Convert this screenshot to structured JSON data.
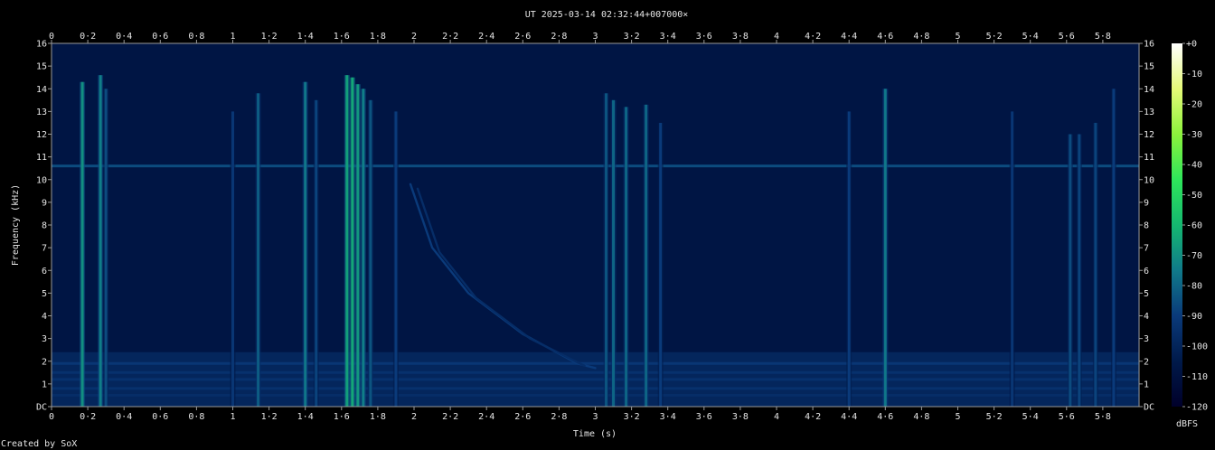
{
  "chart_data": {
    "type": "heatmap",
    "title": "UT 2025-03-14 02:32:44+007000×",
    "xlabel": "Time (s)",
    "ylabel": "Frequency (kHz)",
    "xlim": [
      0,
      6.0
    ],
    "ylim": [
      0,
      16
    ],
    "x_ticks": [
      {
        "value": 0,
        "label": "0"
      },
      {
        "value": 0.2,
        "label": "0·2"
      },
      {
        "value": 0.4,
        "label": "0·4"
      },
      {
        "value": 0.6,
        "label": "0·6"
      },
      {
        "value": 0.8,
        "label": "0·8"
      },
      {
        "value": 1.0,
        "label": "1"
      },
      {
        "value": 1.2,
        "label": "1·2"
      },
      {
        "value": 1.4,
        "label": "1·4"
      },
      {
        "value": 1.6,
        "label": "1·6"
      },
      {
        "value": 1.8,
        "label": "1·8"
      },
      {
        "value": 2.0,
        "label": "2"
      },
      {
        "value": 2.2,
        "label": "2·2"
      },
      {
        "value": 2.4,
        "label": "2·4"
      },
      {
        "value": 2.6,
        "label": "2·6"
      },
      {
        "value": 2.8,
        "label": "2·8"
      },
      {
        "value": 3.0,
        "label": "3"
      },
      {
        "value": 3.2,
        "label": "3·2"
      },
      {
        "value": 3.4,
        "label": "3·4"
      },
      {
        "value": 3.6,
        "label": "3·6"
      },
      {
        "value": 3.8,
        "label": "3·8"
      },
      {
        "value": 4.0,
        "label": "4"
      },
      {
        "value": 4.2,
        "label": "4·2"
      },
      {
        "value": 4.4,
        "label": "4·4"
      },
      {
        "value": 4.6,
        "label": "4·6"
      },
      {
        "value": 4.8,
        "label": "4·8"
      },
      {
        "value": 5.0,
        "label": "5"
      },
      {
        "value": 5.2,
        "label": "5·2"
      },
      {
        "value": 5.4,
        "label": "5·4"
      },
      {
        "value": 5.6,
        "label": "5·6"
      },
      {
        "value": 5.8,
        "label": "5·8"
      }
    ],
    "y_ticks": [
      {
        "value": 0,
        "label": "DC"
      },
      {
        "value": 1,
        "label": "1"
      },
      {
        "value": 2,
        "label": "2"
      },
      {
        "value": 3,
        "label": "3"
      },
      {
        "value": 4,
        "label": "4"
      },
      {
        "value": 5,
        "label": "5"
      },
      {
        "value": 6,
        "label": "6"
      },
      {
        "value": 7,
        "label": "7"
      },
      {
        "value": 8,
        "label": "8"
      },
      {
        "value": 9,
        "label": "9"
      },
      {
        "value": 10,
        "label": "10"
      },
      {
        "value": 11,
        "label": "11"
      },
      {
        "value": 12,
        "label": "12"
      },
      {
        "value": 13,
        "label": "13"
      },
      {
        "value": 14,
        "label": "14"
      },
      {
        "value": 15,
        "label": "15"
      },
      {
        "value": 16,
        "label": "16"
      }
    ],
    "colorbar": {
      "label": "dBFS",
      "range": [
        -120,
        0
      ],
      "ticks": [
        {
          "value": 0,
          "label": "+0"
        },
        {
          "value": -10,
          "label": "-10"
        },
        {
          "value": -20,
          "label": "-20"
        },
        {
          "value": -30,
          "label": "-30"
        },
        {
          "value": -40,
          "label": "-40"
        },
        {
          "value": -50,
          "label": "-50"
        },
        {
          "value": -60,
          "label": "-60"
        },
        {
          "value": -70,
          "label": "-70"
        },
        {
          "value": -80,
          "label": "-80"
        },
        {
          "value": -90,
          "label": "-90"
        },
        {
          "value": -100,
          "label": "-100"
        },
        {
          "value": -110,
          "label": "-110"
        },
        {
          "value": -120,
          "label": "-120"
        }
      ],
      "colors": [
        "#00002a",
        "#001a4a",
        "#0a3a7a",
        "#107a8a",
        "#15b870",
        "#2ee65a",
        "#8cf23c",
        "#e6fa78",
        "#ffffff"
      ]
    },
    "background_noise_dbfs": -108,
    "noise_floor_band": {
      "top_khz": 2.4,
      "dbfs": -98
    },
    "horizontal_bands": [
      {
        "freq_khz": 10.6,
        "dbfs": -86
      },
      {
        "freq_khz": 1.9,
        "dbfs": -92
      },
      {
        "freq_khz": 1.5,
        "dbfs": -94
      },
      {
        "freq_khz": 1.2,
        "dbfs": -94
      },
      {
        "freq_khz": 0.8,
        "dbfs": -94
      },
      {
        "freq_khz": 0.5,
        "dbfs": -96
      }
    ],
    "transients": [
      {
        "time_s": 0.17,
        "max_khz": 14.3,
        "dbfs": -70
      },
      {
        "time_s": 0.27,
        "max_khz": 14.6,
        "dbfs": -74
      },
      {
        "time_s": 0.3,
        "max_khz": 14.0,
        "dbfs": -86
      },
      {
        "time_s": 1.0,
        "max_khz": 13.0,
        "dbfs": -92
      },
      {
        "time_s": 1.14,
        "max_khz": 13.8,
        "dbfs": -82
      },
      {
        "time_s": 1.4,
        "max_khz": 14.3,
        "dbfs": -76
      },
      {
        "time_s": 1.46,
        "max_khz": 13.5,
        "dbfs": -88
      },
      {
        "time_s": 1.63,
        "max_khz": 14.6,
        "dbfs": -66
      },
      {
        "time_s": 1.66,
        "max_khz": 14.5,
        "dbfs": -64
      },
      {
        "time_s": 1.69,
        "max_khz": 14.2,
        "dbfs": -68
      },
      {
        "time_s": 1.72,
        "max_khz": 14.0,
        "dbfs": -74
      },
      {
        "time_s": 1.76,
        "max_khz": 13.5,
        "dbfs": -84
      },
      {
        "time_s": 1.9,
        "max_khz": 13.0,
        "dbfs": -90
      },
      {
        "time_s": 3.06,
        "max_khz": 13.8,
        "dbfs": -84
      },
      {
        "time_s": 3.1,
        "max_khz": 13.5,
        "dbfs": -80
      },
      {
        "time_s": 3.17,
        "max_khz": 13.2,
        "dbfs": -80
      },
      {
        "time_s": 3.28,
        "max_khz": 13.3,
        "dbfs": -80
      },
      {
        "time_s": 3.36,
        "max_khz": 12.5,
        "dbfs": -90
      },
      {
        "time_s": 4.4,
        "max_khz": 13.0,
        "dbfs": -90
      },
      {
        "time_s": 4.6,
        "max_khz": 14.0,
        "dbfs": -76
      },
      {
        "time_s": 5.3,
        "max_khz": 13.0,
        "dbfs": -92
      },
      {
        "time_s": 5.62,
        "max_khz": 12.0,
        "dbfs": -86
      },
      {
        "time_s": 5.67,
        "max_khz": 12.0,
        "dbfs": -88
      },
      {
        "time_s": 5.76,
        "max_khz": 12.5,
        "dbfs": -88
      },
      {
        "time_s": 5.86,
        "max_khz": 14.0,
        "dbfs": -90
      }
    ],
    "sweeps": [
      {
        "points": [
          [
            1.98,
            9.8
          ],
          [
            2.1,
            7.0
          ],
          [
            2.3,
            5.0
          ],
          [
            2.6,
            3.2
          ],
          [
            2.9,
            1.9
          ],
          [
            3.0,
            1.7
          ]
        ],
        "dbfs": -90
      },
      {
        "points": [
          [
            2.02,
            9.6
          ],
          [
            2.14,
            6.8
          ],
          [
            2.34,
            4.8
          ],
          [
            2.64,
            3.0
          ],
          [
            2.94,
            1.8
          ]
        ],
        "dbfs": -96
      }
    ]
  },
  "footer": {
    "credit": "Created by SoX"
  }
}
